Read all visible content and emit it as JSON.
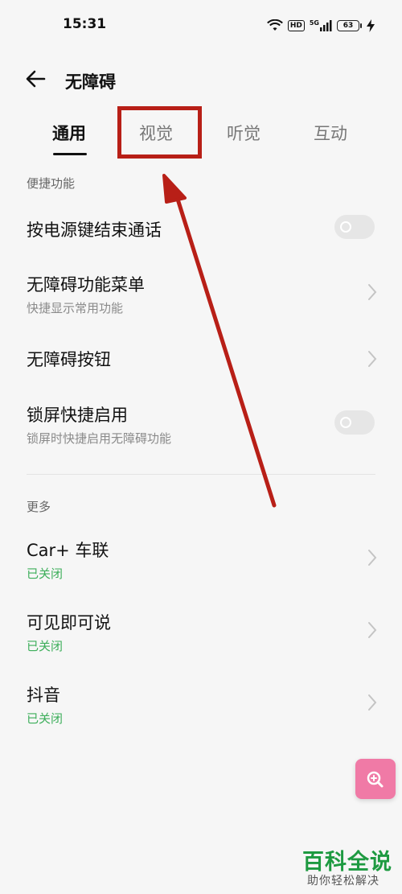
{
  "status_bar": {
    "time": "15:31",
    "hd": "HD",
    "network": "5G",
    "battery": "63"
  },
  "header": {
    "title": "无障碍"
  },
  "tabs": [
    {
      "label": "通用",
      "active": true
    },
    {
      "label": "视觉",
      "active": false
    },
    {
      "label": "听觉",
      "active": false
    },
    {
      "label": "互动",
      "active": false
    }
  ],
  "sections": {
    "shortcuts": {
      "header": "便捷功能",
      "items": [
        {
          "title": "按电源键结束通话",
          "control": "toggle",
          "on": false
        },
        {
          "title": "无障碍功能菜单",
          "subtitle": "快捷显示常用功能",
          "control": "chevron"
        },
        {
          "title": "无障碍按钮",
          "control": "chevron"
        },
        {
          "title": "锁屏快捷启用",
          "subtitle": "锁屏时快捷启用无障碍功能",
          "control": "toggle",
          "on": false
        }
      ]
    },
    "more": {
      "header": "更多",
      "items": [
        {
          "title": "Car+ 车联",
          "subtitle": "已关闭",
          "control": "chevron"
        },
        {
          "title": "可见即可说",
          "subtitle": "已关闭",
          "control": "chevron"
        },
        {
          "title": "抖音",
          "subtitle": "已关闭",
          "control": "chevron"
        }
      ]
    }
  },
  "fab_icon": "zoom-in-icon",
  "colors": {
    "background": "#f6f6f6",
    "status_green": "#3cae5a",
    "fab_pink": "#f07aa6",
    "annotation_red": "#b81f17",
    "watermark_green": "#1e9a41"
  },
  "watermark": {
    "logo": "百科全说",
    "slogan": "助你轻松解决"
  }
}
